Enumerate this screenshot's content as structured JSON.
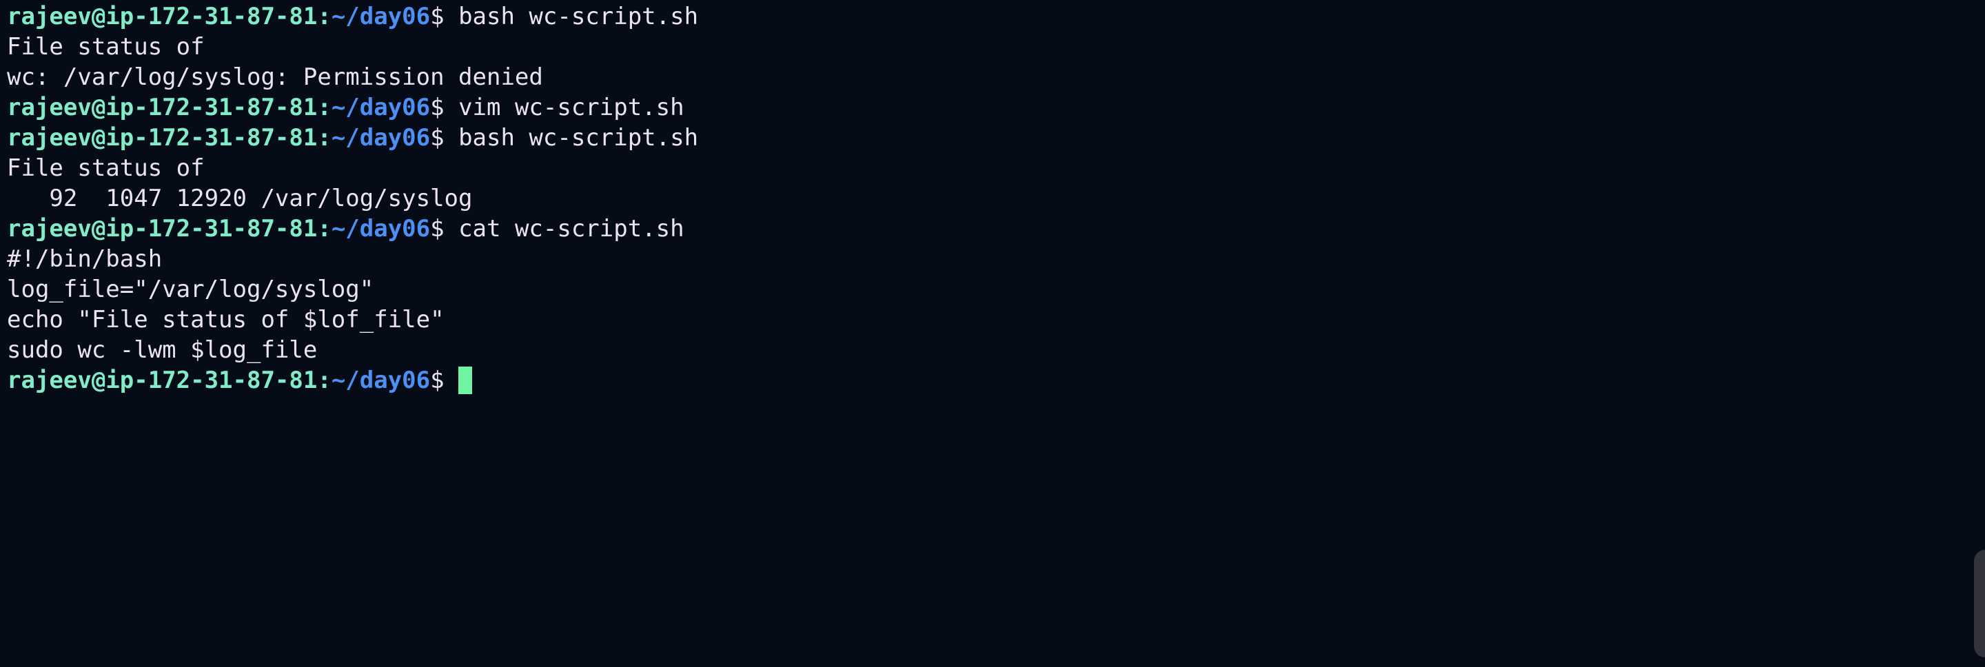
{
  "prompt": {
    "user_host": "rajeev@ip-172-31-87-81",
    "sep": ":",
    "path": "~/day06",
    "symbol": "$ "
  },
  "lines": [
    {
      "type": "cmd",
      "text": "bash wc-script.sh"
    },
    {
      "type": "out",
      "text": "File status of"
    },
    {
      "type": "out",
      "text": "wc: /var/log/syslog: Permission denied"
    },
    {
      "type": "cmd",
      "text": "vim wc-script.sh"
    },
    {
      "type": "cmd",
      "text": "bash wc-script.sh"
    },
    {
      "type": "out",
      "text": "File status of"
    },
    {
      "type": "out",
      "text": "   92  1047 12920 /var/log/syslog"
    },
    {
      "type": "cmd",
      "text": "cat wc-script.sh"
    },
    {
      "type": "out",
      "text": "#!/bin/bash"
    },
    {
      "type": "out",
      "text": "log_file=\"/var/log/syslog\""
    },
    {
      "type": "out",
      "text": "echo \"File status of $lof_file\""
    },
    {
      "type": "out",
      "text": "sudo wc -lwm $log_file"
    },
    {
      "type": "cmd",
      "text": ""
    }
  ],
  "colors": {
    "background": "#050b17",
    "prompt_user": "#82ecc8",
    "prompt_path": "#4d8ff2",
    "text": "#ebe4ee",
    "cursor": "#6ff5a4"
  }
}
